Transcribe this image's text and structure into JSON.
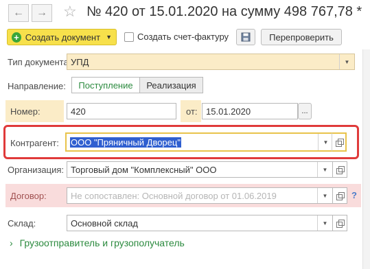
{
  "window": {
    "title": "№ 420 от 15.01.2020 на сумму 498 767,78 *"
  },
  "toolbar": {
    "create_document_label": "Создать документ",
    "create_invoice_label": "Создать счет-фактуру",
    "recheck_label": "Перепроверить"
  },
  "form": {
    "doc_type": {
      "label": "Тип документа:",
      "value": "УПД"
    },
    "direction": {
      "label": "Направление:",
      "options": [
        "Поступление",
        "Реализация"
      ],
      "selected": "Поступление"
    },
    "number": {
      "label": "Номер:",
      "value": "420",
      "date_label": "от:",
      "date_value": "15.01.2020",
      "date_button": "..."
    },
    "counterparty": {
      "label": "Контрагент:",
      "value": "ООО \"Пряничный Дворец\""
    },
    "organization": {
      "label": "Организация:",
      "value": "Торговый дом \"Комплексный\" ООО"
    },
    "contract": {
      "label": "Договор:",
      "placeholder": "Не сопоставлен: Основной договор от 01.06.2019",
      "help": "?"
    },
    "warehouse": {
      "label": "Склад:",
      "value": "Основной склад"
    },
    "shipper_section": {
      "label": "Грузоотправитель и грузополучатель"
    }
  },
  "colors": {
    "accent_yellow": "#f7e04b",
    "highlight_red": "#e03a3a",
    "green": "#2b8a3e",
    "selection_blue": "#2f5fd0"
  }
}
